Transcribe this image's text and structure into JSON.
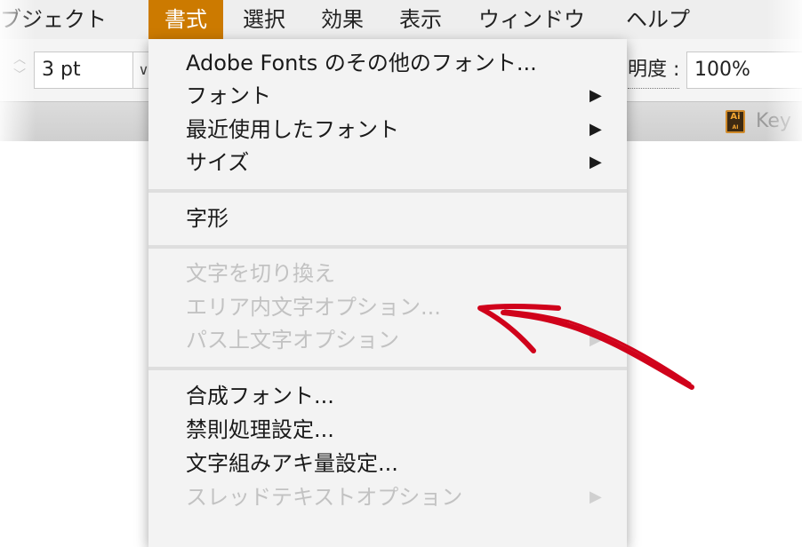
{
  "menubar": {
    "items": [
      "ブジェクト",
      "書式",
      "選択",
      "効果",
      "表示",
      "ウィンドウ",
      "ヘルプ"
    ],
    "active": "書式",
    "accent": "#cc7a00"
  },
  "toolbar": {
    "stroke_value": "3 pt",
    "opacity_label": "明度 :",
    "opacity_value": "100%"
  },
  "tab": {
    "icon_text": "Ai",
    "label": "Key"
  },
  "menu": {
    "items": [
      {
        "label": "Adobe Fonts のその他のフォント...",
        "enabled": true,
        "submenu": false
      },
      {
        "label": "フォント",
        "enabled": true,
        "submenu": true
      },
      {
        "label": "最近使用したフォント",
        "enabled": true,
        "submenu": true
      },
      {
        "label": "サイズ",
        "enabled": true,
        "submenu": true
      },
      {
        "label": "字形",
        "enabled": true,
        "submenu": false
      },
      {
        "label": "文字を切り換え",
        "enabled": false,
        "submenu": false
      },
      {
        "label": "エリア内文字オプション...",
        "enabled": false,
        "submenu": false
      },
      {
        "label": "パス上文字オプション",
        "enabled": false,
        "submenu": true
      },
      {
        "label": "合成フォント...",
        "enabled": true,
        "submenu": false
      },
      {
        "label": "禁則処理設定...",
        "enabled": true,
        "submenu": false
      },
      {
        "label": "文字組みアキ量設定...",
        "enabled": true,
        "submenu": false
      },
      {
        "label": "スレッドテキストオプション",
        "enabled": false,
        "submenu": true
      }
    ],
    "arrow_glyph": "▶"
  },
  "annotation": {
    "type": "arrow",
    "color": "#d0021b"
  }
}
